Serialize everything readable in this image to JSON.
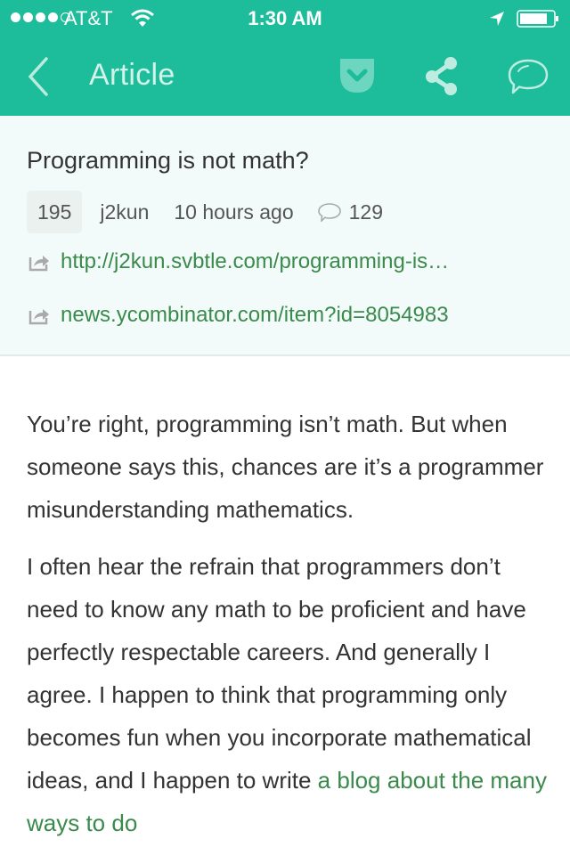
{
  "status_bar": {
    "carrier": "AT&T",
    "signal_bars_filled": 4,
    "signal_bars_total": 5,
    "time": "1:30 AM",
    "battery_level": 0.8
  },
  "nav": {
    "title": "Article",
    "icons": [
      "back-chevron-icon",
      "pocket-icon",
      "share-icon",
      "comment-bubble-icon"
    ]
  },
  "article": {
    "title": "Programming is not math?",
    "points": "195",
    "author": "j2kun",
    "time_ago": "10 hours ago",
    "comment_count": "129",
    "links": [
      {
        "text": "http://j2kun.svbtle.com/programming-is…"
      },
      {
        "text": "news.ycombinator.com/item?id=8054983"
      }
    ]
  },
  "body": {
    "paragraph1": "You’re right, programming isn’t math. But when someone says this, chances are it’s a programmer misunderstanding mathematics.",
    "paragraph2_text": "I often hear the refrain that programmers don’t need to know any math to be proficient and have perfectly respectable careers. And generally I agree. I happen to think that programming only becomes fun when you incorporate mathematical ideas, and I happen to write ",
    "paragraph2_link": "a blog about the many ways to do"
  },
  "colors": {
    "accent": "#1dbc9a",
    "link": "#3a8a4c",
    "header_bg": "#f2fbf9"
  }
}
